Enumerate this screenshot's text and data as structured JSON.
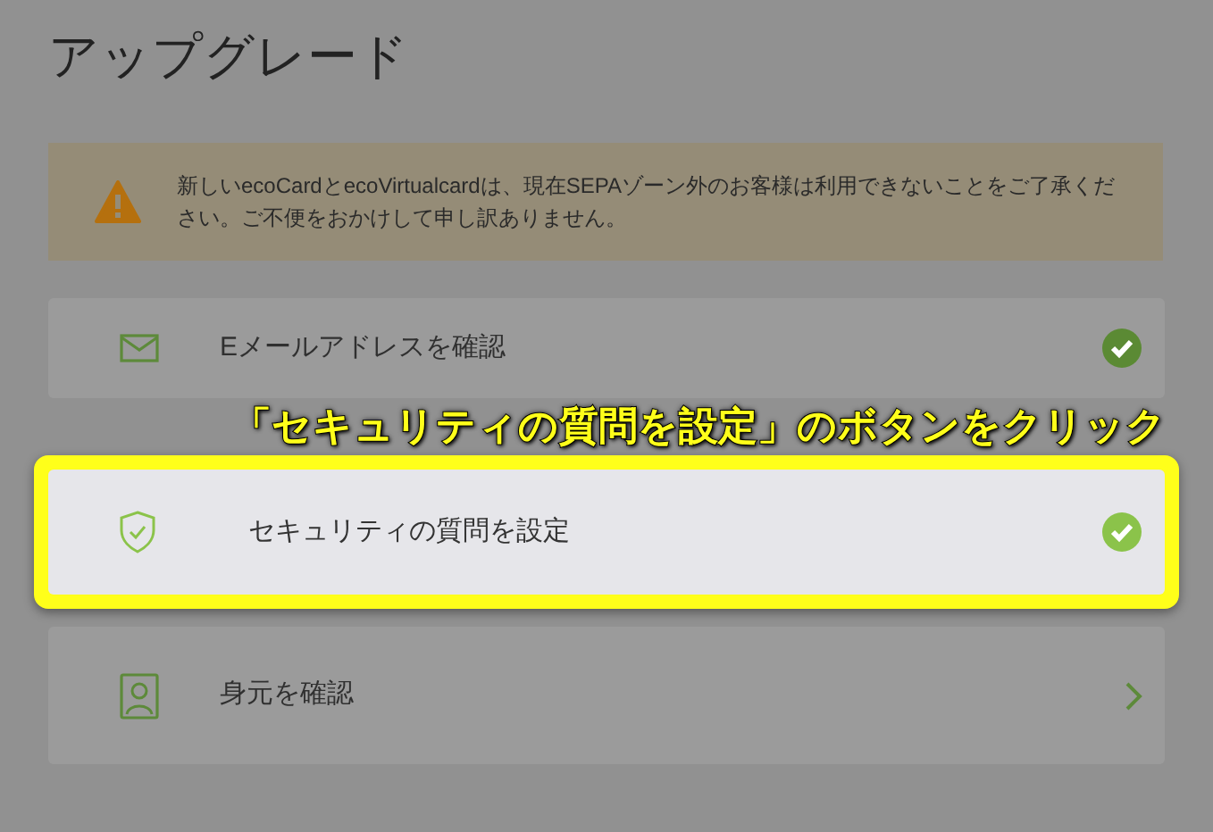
{
  "title": "アップグレード",
  "warning": {
    "text": "新しいecoCardとecoVirtualcardは、現在SEPAゾーン外のお客様は利用できないことをご了承ください。ご不便をおかけして申し訳ありません。"
  },
  "steps": [
    {
      "kind": "mail",
      "label": "Eメールアドレスを確認",
      "done": true,
      "highlighted": false
    },
    {
      "kind": "shield",
      "label": "セキュリティの質問を設定",
      "done": true,
      "highlighted": true
    },
    {
      "kind": "person",
      "label": "身元を確認",
      "done": false,
      "highlighted": false
    }
  ],
  "annotation": {
    "text": "「セキュリティの質問を設定」のボタンをクリック"
  }
}
